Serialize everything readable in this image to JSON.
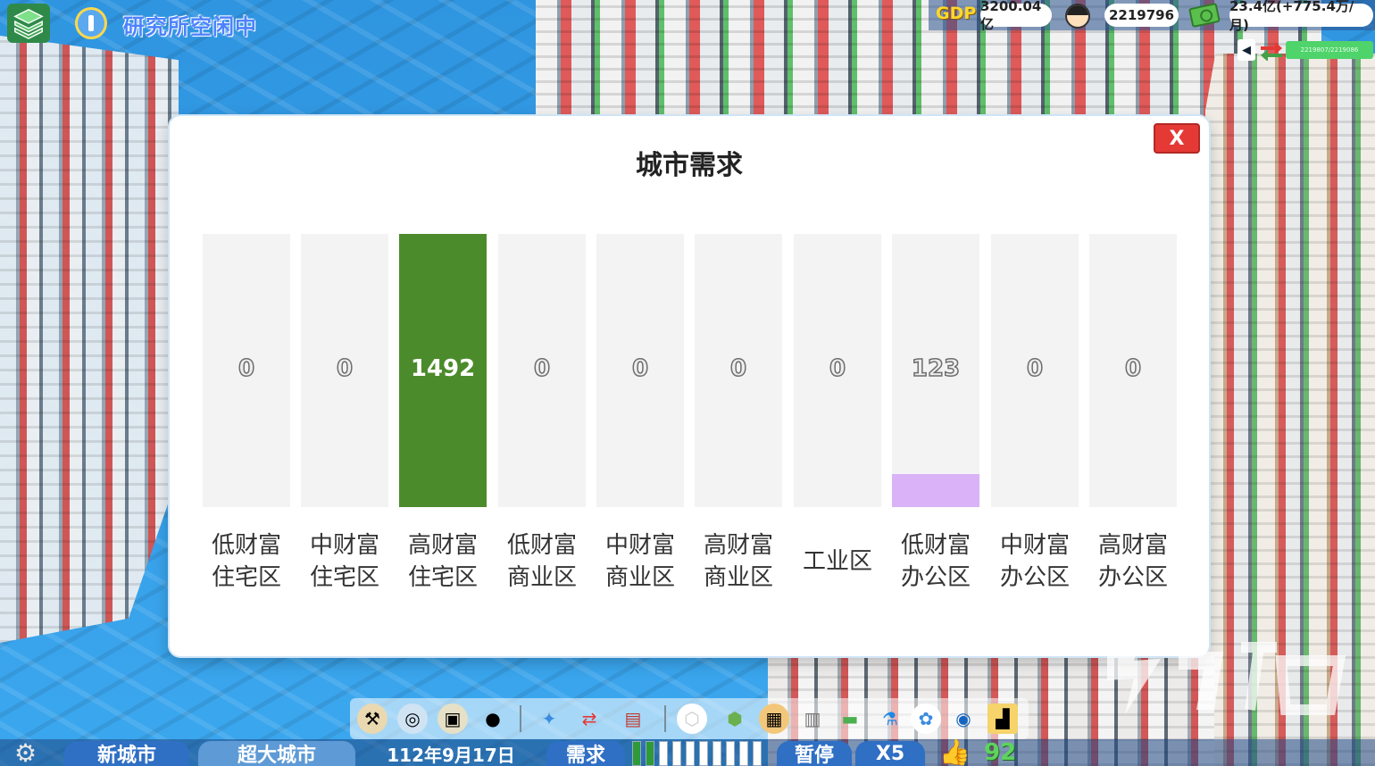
{
  "hud": {
    "research_status": "研究所空闲中",
    "gdp_label": "GDP",
    "gdp_value": "3200.04亿",
    "population": "2219796",
    "money": "23.4亿(+775.4万/月)",
    "trade_bar_text": "2219807/2219086"
  },
  "dialog": {
    "title": "城市需求",
    "close_label": "X",
    "columns": [
      {
        "line1": "低财富",
        "line2": "住宅区",
        "value": "0",
        "fill_fraction": 0,
        "color": "#f3f3f3"
      },
      {
        "line1": "中财富",
        "line2": "住宅区",
        "value": "0",
        "fill_fraction": 0,
        "color": "#f3f3f3"
      },
      {
        "line1": "高财富",
        "line2": "住宅区",
        "value": "1492",
        "fill_fraction": 1.0,
        "color": "#4c8b2b"
      },
      {
        "line1": "低财富",
        "line2": "商业区",
        "value": "0",
        "fill_fraction": 0,
        "color": "#f3f3f3"
      },
      {
        "line1": "中财富",
        "line2": "商业区",
        "value": "0",
        "fill_fraction": 0,
        "color": "#f3f3f3"
      },
      {
        "line1": "高财富",
        "line2": "商业区",
        "value": "0",
        "fill_fraction": 0,
        "color": "#f3f3f3"
      },
      {
        "line1": "工业区",
        "line2": "",
        "value": "0",
        "fill_fraction": 0,
        "color": "#f3f3f3"
      },
      {
        "line1": "低财富",
        "line2": "办公区",
        "value": "123",
        "fill_fraction": 0.12,
        "color": "#d9b2f7"
      },
      {
        "line1": "中财富",
        "line2": "办公区",
        "value": "0",
        "fill_fraction": 0,
        "color": "#f3f3f3"
      },
      {
        "line1": "高财富",
        "line2": "办公区",
        "value": "0",
        "fill_fraction": 0,
        "color": "#f3f3f3"
      }
    ]
  },
  "bottom": {
    "new_city": "新城市",
    "city_size": "超大城市",
    "date": "112年9月17日",
    "demand": "需求",
    "pause": "暂停",
    "speed": "X5",
    "approval": "92"
  },
  "toolbar_icons": [
    "construction-icon",
    "metro-icon",
    "bulldozer-icon",
    "disaster-icon",
    "policy-icon",
    "transfer-icon",
    "statistics-icon",
    "zone-hex-icon",
    "district-icon",
    "landmark-icon",
    "building-icon",
    "finance-icon",
    "research-flask-icon",
    "flower-icon",
    "view-eye-icon",
    "industry-icon"
  ]
}
